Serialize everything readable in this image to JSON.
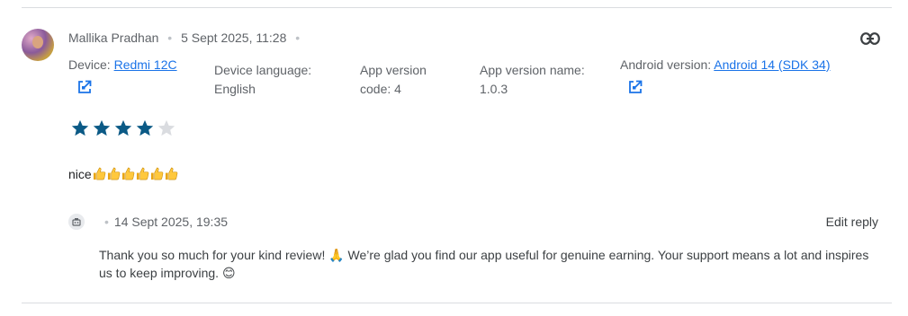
{
  "review": {
    "author": "Mallika Pradhan",
    "date": "5 Sept 2025, 11:28",
    "device_label": "Device:",
    "device_value": "Redmi 12C",
    "language_label": "Device language:",
    "language_value": "English",
    "app_version_code_label": "App version",
    "app_version_code_value": "code: 4",
    "app_version_name_label": "App version name:",
    "app_version_name_value": "1.0.3",
    "android_label": "Android version:",
    "android_value": "Android 14 (SDK 34)",
    "rating": 4,
    "rating_max": 5,
    "text": "nice",
    "thumbs_count": 6,
    "star_color": "#0b5a86",
    "star_empty_color": "#dadce0"
  },
  "reply": {
    "date": "14 Sept 2025, 19:35",
    "edit_label": "Edit reply",
    "text": "Thank you so much for your kind review! 🙏 We’re glad you find our app useful for genuine earning. Your support means a lot and inspires us to keep improving. 😊"
  },
  "icons": {
    "link": "link-icon",
    "external": "open-in-new-icon",
    "reply_avatar": "developer-avatar-icon",
    "thumbs_up": "thumbs-up-emoji"
  }
}
